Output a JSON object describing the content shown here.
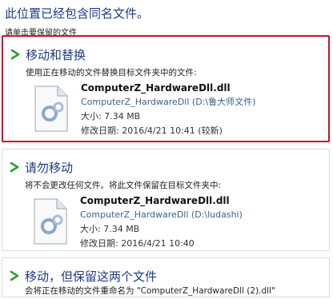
{
  "dialog": {
    "heading": "此位置已经包含同名文件。",
    "subheading": "请单击要保留的文件"
  },
  "options": [
    {
      "title": "移动和替换",
      "description": "使用正在移动的文件替换目标文件夹中的文件:",
      "selected": true,
      "file": {
        "name": "ComputerZ_HardwareDll.dll",
        "path": "ComputerZ_HardwareDll (D:\\鲁大师文件)",
        "size": "大小: 7.34 MB",
        "modified": "修改日期: 2016/4/21 10:41 (较新)"
      }
    },
    {
      "title": "请勿移动",
      "description": "将不会更改任何文件。将此文件保留在目标文件夹中:",
      "selected": false,
      "file": {
        "name": "ComputerZ_HardwareDll.dll",
        "path": "ComputerZ_HardwareDll (D:\\ludashi)",
        "size": "大小: 7.34 MB",
        "modified": "修改日期: 2016/4/21 10:40"
      }
    },
    {
      "title": "移动，但保留这两个文件",
      "description": "会将正在移动的文件重命名为 \"ComputerZ_HardwareDll (2).dll\"",
      "selected": false
    }
  ],
  "colors": {
    "title_blue": "#1e3a8a",
    "selection_border": "#c8102e",
    "arrow_green": "#2e9e2e"
  },
  "icons": {
    "arrow": "green-right-arrow-icon",
    "file": "dll-gear-file-icon"
  }
}
